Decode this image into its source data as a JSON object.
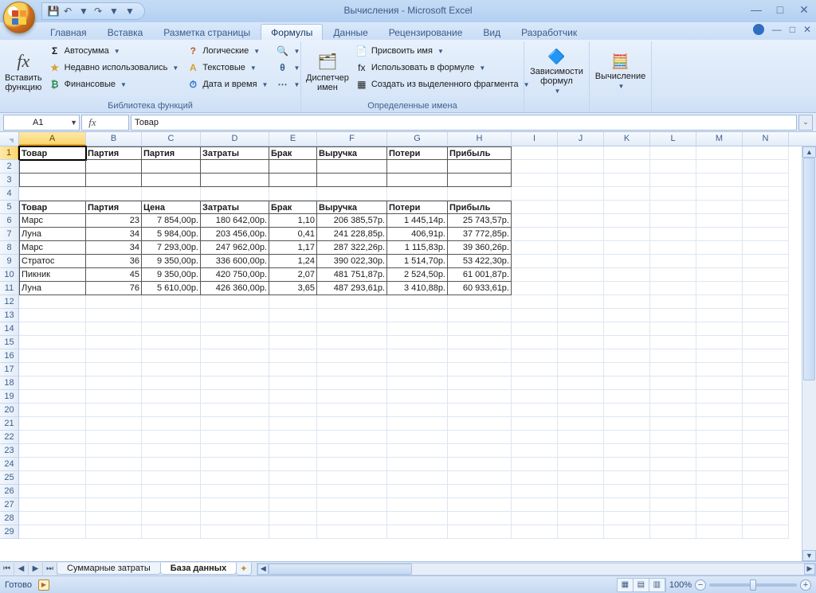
{
  "title": "Вычисления - Microsoft Excel",
  "qat": {
    "save": "💾",
    "undo": "↶",
    "redo": "↷"
  },
  "tabs": [
    "Главная",
    "Вставка",
    "Разметка страницы",
    "Формулы",
    "Данные",
    "Рецензирование",
    "Вид",
    "Разработчик"
  ],
  "active_tab_index": 3,
  "ribbon": {
    "groups": [
      {
        "title": "Библиотека функций",
        "big": {
          "label": "Вставить\nфункцию"
        },
        "col1": [
          {
            "icon": "Σ",
            "label": "Автосумма",
            "color": "#1a1a1a"
          },
          {
            "icon": "★",
            "label": "Недавно использовались",
            "color": "#d8a030"
          },
          {
            "icon": "₿",
            "label": "Финансовые",
            "color": "#2a8a4a"
          }
        ],
        "col2": [
          {
            "icon": "?",
            "label": "Логические",
            "color": "#c05a20"
          },
          {
            "icon": "A",
            "label": "Текстовые",
            "color": "#d8a030"
          },
          {
            "icon": "⏱",
            "label": "Дата и время",
            "color": "#2a70c8"
          }
        ],
        "col3": [
          {
            "icon": "🔍",
            "label": ""
          },
          {
            "icon": "θ",
            "label": ""
          },
          {
            "icon": "⋯",
            "label": ""
          }
        ]
      },
      {
        "title": "Определенные имена",
        "big": {
          "label": "Диспетчер\nимен"
        },
        "items": [
          {
            "icon": "📄",
            "label": "Присвоить имя"
          },
          {
            "icon": "fx",
            "label": "Использовать в формуле"
          },
          {
            "icon": "▦",
            "label": "Создать из выделенного фрагмента"
          }
        ]
      },
      {
        "title": "",
        "big": {
          "label": "Зависимости\nформул"
        }
      },
      {
        "title": "",
        "big": {
          "label": "Вычисление"
        }
      }
    ]
  },
  "namebox": "A1",
  "formula": "Товар",
  "columns": [
    "A",
    "B",
    "C",
    "D",
    "E",
    "F",
    "G",
    "H",
    "I",
    "J",
    "K",
    "L",
    "M",
    "N"
  ],
  "col_widths": [
    "cA",
    "cB",
    "cC",
    "cD",
    "cE",
    "cF",
    "cG",
    "cH",
    "cR",
    "cR",
    "cR",
    "cR",
    "cR",
    "cR"
  ],
  "header_row1": [
    "Товар",
    "Партия",
    "Партия",
    "Затраты",
    "Брак",
    "Выручка",
    "Потери",
    "Прибыль"
  ],
  "header_row5": [
    "Товар",
    "Партия",
    "Цена",
    "Затраты",
    "Брак",
    "Выручка",
    "Потери",
    "Прибыль"
  ],
  "data_rows": [
    [
      "Марс",
      "23",
      "7 854,00р.",
      "180 642,00р.",
      "1,10",
      "206 385,57р.",
      "1 445,14р.",
      "25 743,57р."
    ],
    [
      "Луна",
      "34",
      "5 984,00р.",
      "203 456,00р.",
      "0,41",
      "241 228,85р.",
      "406,91р.",
      "37 772,85р."
    ],
    [
      "Марс",
      "34",
      "7 293,00р.",
      "247 962,00р.",
      "1,17",
      "287 322,26р.",
      "1 115,83р.",
      "39 360,26р."
    ],
    [
      "Стратос",
      "36",
      "9 350,00р.",
      "336 600,00р.",
      "1,24",
      "390 022,30р.",
      "1 514,70р.",
      "53 422,30р."
    ],
    [
      "Пикник",
      "45",
      "9 350,00р.",
      "420 750,00р.",
      "2,07",
      "481 751,87р.",
      "2 524,50р.",
      "61 001,87р."
    ],
    [
      "Луна",
      "76",
      "5 610,00р.",
      "426 360,00р.",
      "3,65",
      "487 293,61р.",
      "3 410,88р.",
      "60 933,61р."
    ]
  ],
  "row_numbers": [
    1,
    2,
    3,
    4,
    5,
    6,
    7,
    8,
    9,
    10,
    11,
    12,
    13,
    14,
    15,
    16,
    17,
    18,
    19,
    20,
    21,
    22,
    23,
    24,
    25,
    26,
    27,
    28,
    29
  ],
  "sheets": [
    "Суммарные затраты",
    "База данных"
  ],
  "active_sheet_index": 1,
  "status": "Готово",
  "zoom": "100%",
  "macro_icon": "▶"
}
